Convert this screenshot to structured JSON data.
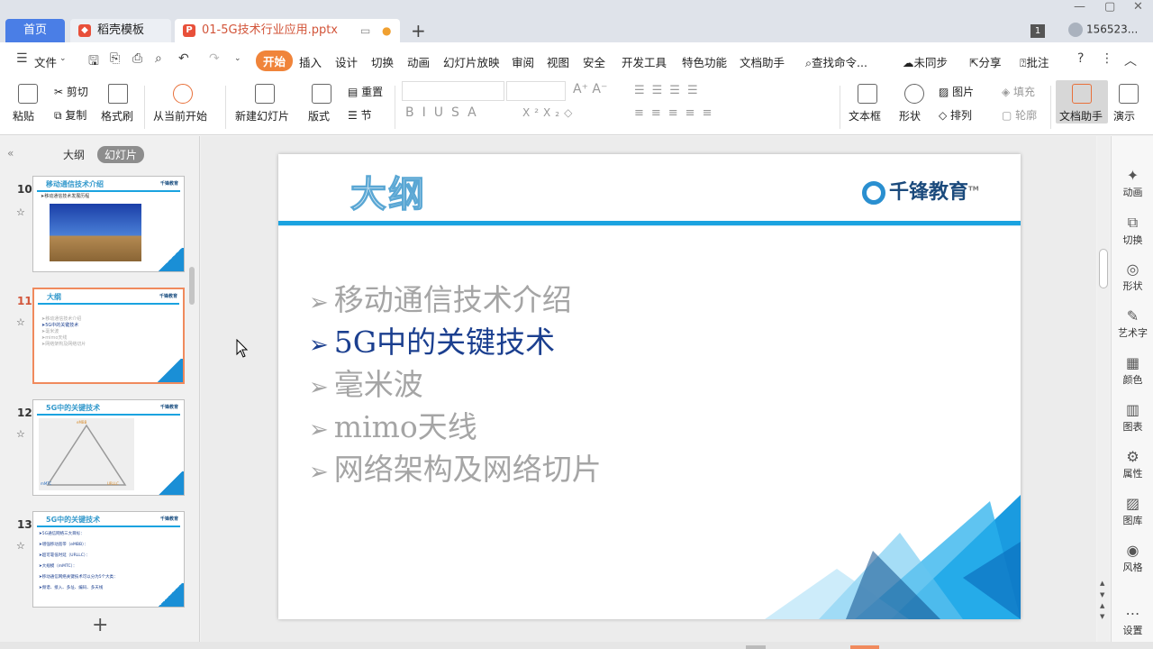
{
  "tabs": {
    "home": "首页",
    "template": "稻壳模板",
    "document": "01-5G技术行业应用.pptx",
    "user_id": "156523...",
    "page_badge": "1"
  },
  "menu": {
    "file": "文件",
    "items": [
      "开始",
      "插入",
      "设计",
      "切换",
      "动画",
      "幻灯片放映",
      "审阅",
      "视图",
      "安全",
      "开发工具",
      "特色功能",
      "文档助手"
    ],
    "search": "查找命令...",
    "sync": "未同步",
    "share": "分享",
    "comment": "批注"
  },
  "ribbon": {
    "paste": "粘贴",
    "cut": "剪切",
    "copy": "复制",
    "format_painter": "格式刷",
    "from_current": "从当前开始",
    "new_slide": "新建幻灯片",
    "layout": "版式",
    "reset": "重置",
    "section": "节",
    "textbox": "文本框",
    "shape": "形状",
    "picture": "图片",
    "fill": "填充",
    "arrange": "排列",
    "outline": "轮廓",
    "doc_assistant": "文档助手",
    "present": "演示"
  },
  "left_panel": {
    "outline_tab": "大纲",
    "slides_tab": "幻灯片",
    "slides": [
      {
        "num": "10",
        "title": "移动通信技术介绍",
        "body": [
          "➤移动通信技术发展历程"
        ]
      },
      {
        "num": "11",
        "title": "大纲",
        "body": [
          "➤移动通信技术介绍",
          "➤5G中的关键技术",
          "➤毫米波",
          "➤mimo天线",
          "➤网络架构及网络切片"
        ]
      },
      {
        "num": "12",
        "title": "5G中的关键技术",
        "body": [
          "eMBB",
          "mMTC",
          "URLLC"
        ]
      },
      {
        "num": "13",
        "title": "5G中的关键技术",
        "body": [
          "➤5G通信网络三大目标：",
          "➤增强移动宽带（eMBB）：",
          "➤超可靠低时延（URLLC）：",
          "➤大规模（mMTC）：",
          "➤移动通信网络关键技术可以分为5个大类：",
          "➤频谱、接入、多址、编码、多天线"
        ]
      }
    ]
  },
  "slide": {
    "title": "大纲",
    "logo": "千锋教育",
    "logo_tm": "TM",
    "bullets": [
      {
        "text": "移动通信技术介绍",
        "highlight": false
      },
      {
        "text": "5G中的关键技术",
        "highlight": true
      },
      {
        "text": "毫米波",
        "highlight": false
      },
      {
        "text": "mimo天线",
        "highlight": false
      },
      {
        "text": "网络架构及网络切片",
        "highlight": false
      }
    ],
    "bullet_glyph": "➢",
    "accent_color": "#1aa3e0",
    "highlight_color": "#1b3f8f",
    "muted_color": "#a5a5a5"
  },
  "right_panel": {
    "items": [
      "动画",
      "切换",
      "形状",
      "艺术字",
      "颜色",
      "图表",
      "属性",
      "图库",
      "风格",
      "设置"
    ]
  }
}
